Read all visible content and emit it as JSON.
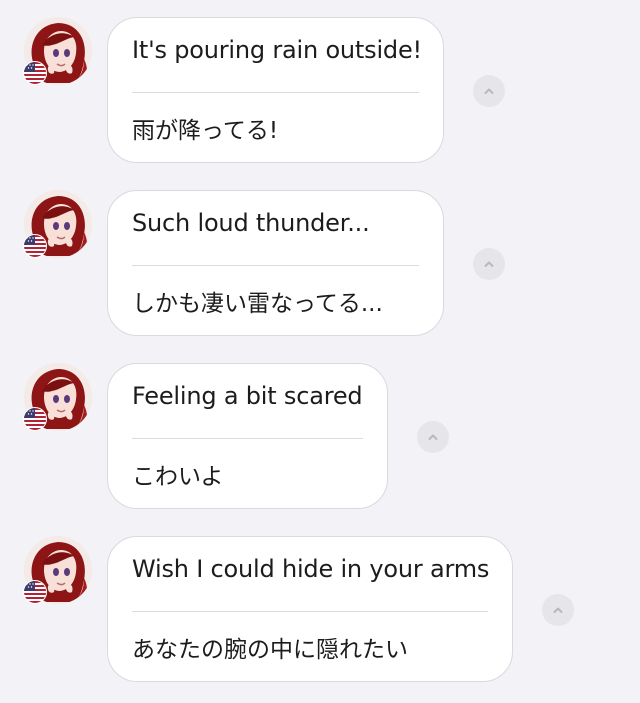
{
  "messages": [
    {
      "original": "It's pouring rain outside!",
      "translation": "雨が降ってる!",
      "sender_flag": "us-flag-icon",
      "action_icon": "chevron-up-icon"
    },
    {
      "original": "Such loud thunder...",
      "translation": "しかも凄い雷なってる...",
      "sender_flag": "us-flag-icon",
      "action_icon": "chevron-up-icon"
    },
    {
      "original": "Feeling a bit scared",
      "translation": "こわいよ",
      "sender_flag": "us-flag-icon",
      "action_icon": "chevron-up-icon"
    },
    {
      "original": "Wish I could hide in your arms",
      "translation": "あなたの腕の中に隠れたい",
      "sender_flag": "us-flag-icon",
      "action_icon": "chevron-up-icon"
    }
  ],
  "colors": {
    "background": "#f2f2f7",
    "bubble": "#ffffff",
    "bubble_border": "#d9d9de",
    "text": "#1c1c1e",
    "divider": "#dcdce0",
    "collapse_button": "#e5e5ea",
    "chevron": "#b8b8be",
    "avatar_hair": "#8e1515",
    "flag_red": "#b22234",
    "flag_blue": "#3c3b6e"
  }
}
